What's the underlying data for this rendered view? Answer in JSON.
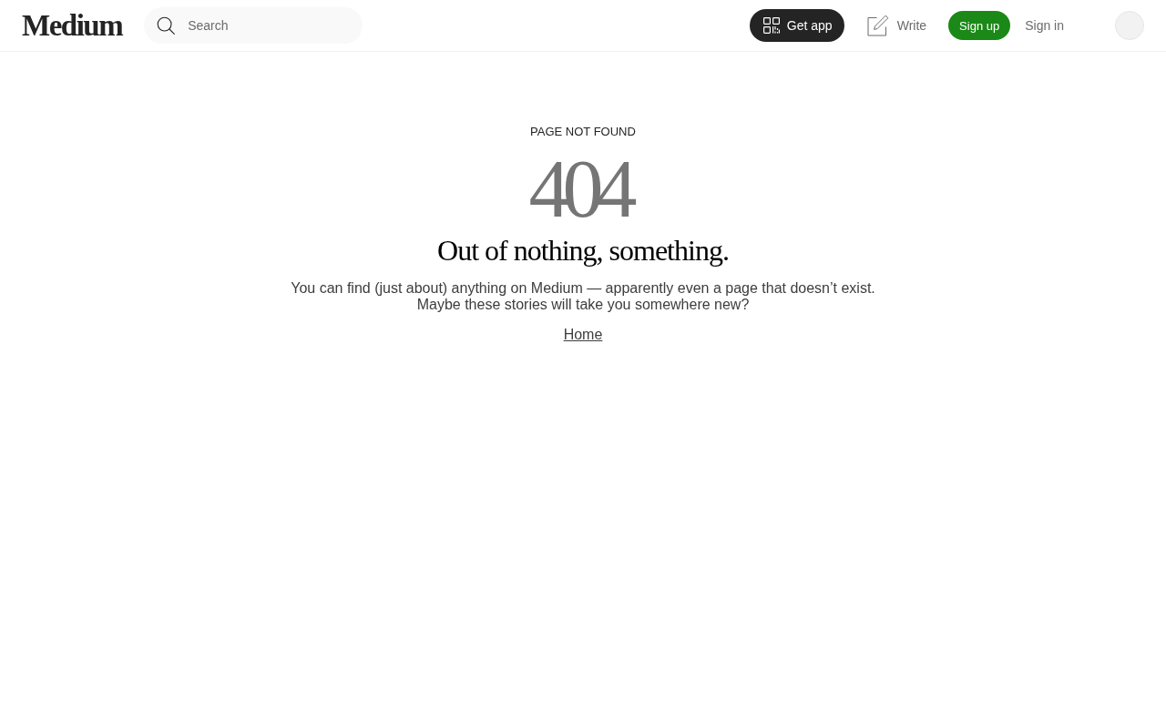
{
  "header": {
    "logo": "Medium",
    "search": {
      "placeholder": "Search"
    },
    "actions": [
      {
        "kind": "app",
        "label": "Get app"
      },
      {
        "kind": "write",
        "label": "Write"
      },
      {
        "kind": "primary",
        "label": "Sign up"
      },
      {
        "kind": "link",
        "label": "Sign in"
      }
    ]
  },
  "content": {
    "eyebrow": "PAGE NOT FOUND",
    "code": "404",
    "heading": "Out of nothing, something.",
    "message": "You can find (just about) anything on Medium — apparently even a page that doesn’t exist. Maybe these stories will take you somewhere new?",
    "link": "Home"
  }
}
